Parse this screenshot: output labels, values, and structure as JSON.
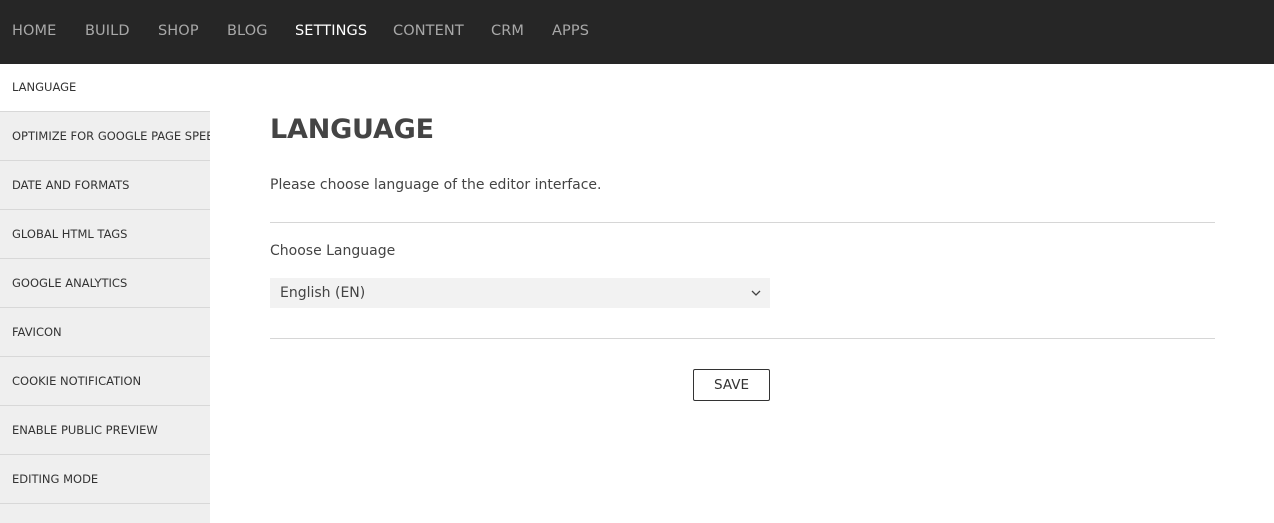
{
  "topnav": {
    "items": [
      {
        "label": "HOME",
        "active": false
      },
      {
        "label": "BUILD",
        "active": false
      },
      {
        "label": "SHOP",
        "active": false
      },
      {
        "label": "BLOG",
        "active": false
      },
      {
        "label": "SETTINGS",
        "active": true
      },
      {
        "label": "CONTENT",
        "active": false
      },
      {
        "label": "CRM",
        "active": false
      },
      {
        "label": "APPS",
        "active": false
      }
    ]
  },
  "sidebar": {
    "items": [
      {
        "label": "LANGUAGE",
        "active": true
      },
      {
        "label": "OPTIMIZE FOR GOOGLE PAGE SPEED",
        "active": false
      },
      {
        "label": "DATE AND FORMATS",
        "active": false
      },
      {
        "label": "GLOBAL HTML TAGS",
        "active": false
      },
      {
        "label": "GOOGLE ANALYTICS",
        "active": false
      },
      {
        "label": "FAVICON",
        "active": false
      },
      {
        "label": "COOKIE NOTIFICATION",
        "active": false
      },
      {
        "label": "ENABLE PUBLIC PREVIEW",
        "active": false
      },
      {
        "label": "EDITING MODE",
        "active": false
      }
    ]
  },
  "main": {
    "title": "LANGUAGE",
    "description": "Please choose language of the editor interface.",
    "field_label": "Choose Language",
    "select": {
      "value": "English (EN)",
      "icon": "chevron-down-icon"
    },
    "save_label": "SAVE"
  },
  "colors": {
    "topbar_bg": "#262626",
    "nav_active": "#ffffff",
    "nav_inactive": "#a8a8a8",
    "sidebar_bg": "#efefef",
    "select_bg": "#f2f2f2"
  }
}
